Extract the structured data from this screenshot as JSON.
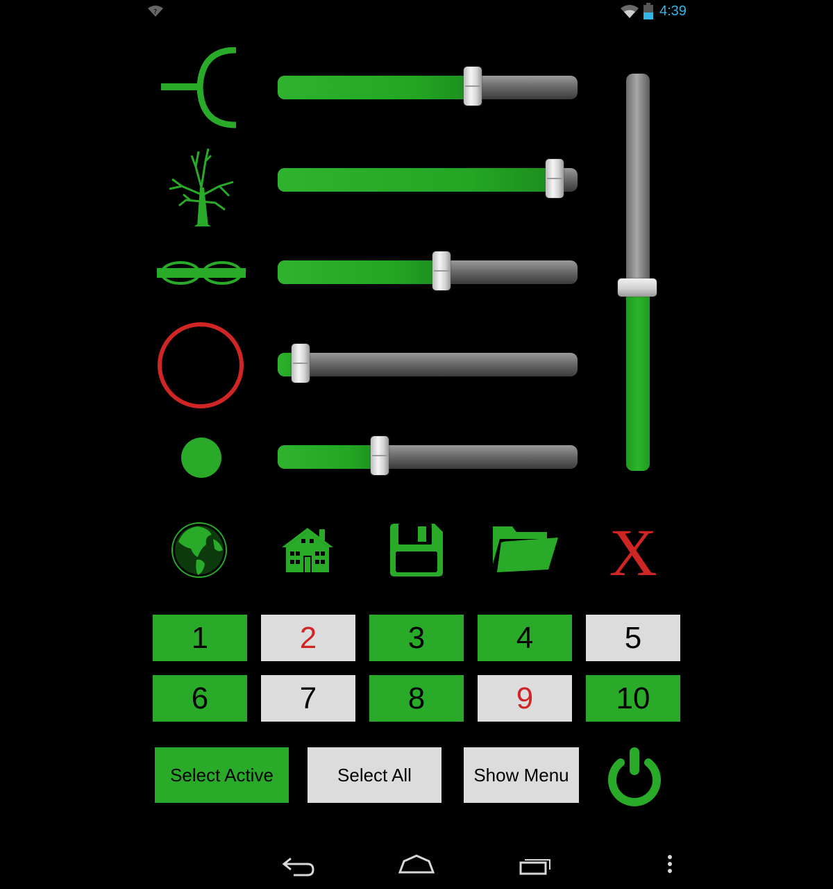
{
  "status_bar": {
    "time": "4:39",
    "icons": [
      "wifi-unknown-icon",
      "wifi-icon",
      "battery-icon"
    ]
  },
  "colors": {
    "accent_green": "#29aa29",
    "inactive_grey": "#dcdcdc",
    "alert_red": "#d02525",
    "status_blue": "#33b5e5"
  },
  "effects": [
    {
      "icon": "antenna-arc-icon",
      "level": 0.66
    },
    {
      "icon": "tree-icon",
      "level": 0.95
    },
    {
      "icon": "glasses-icon",
      "level": 0.55
    },
    {
      "icon": "ring-icon",
      "level": 0.05
    },
    {
      "icon": "dot-icon",
      "level": 0.33
    }
  ],
  "vertical_slider": {
    "level": 0.46
  },
  "toolbar": [
    "globe-icon",
    "house-icon",
    "floppy-disk-icon",
    "folder-icon",
    "close-x-icon"
  ],
  "channels": [
    {
      "label": "1",
      "active": true,
      "red": false
    },
    {
      "label": "2",
      "active": false,
      "red": true
    },
    {
      "label": "3",
      "active": true,
      "red": false
    },
    {
      "label": "4",
      "active": true,
      "red": false
    },
    {
      "label": "5",
      "active": false,
      "red": false
    },
    {
      "label": "6",
      "active": true,
      "red": false
    },
    {
      "label": "7",
      "active": false,
      "red": false
    },
    {
      "label": "8",
      "active": true,
      "red": false
    },
    {
      "label": "9",
      "active": false,
      "red": true
    },
    {
      "label": "10",
      "active": true,
      "red": false
    }
  ],
  "buttons": {
    "select_active": "Select Active",
    "select_all": "Select All",
    "show_menu": "Show Menu"
  },
  "nav_bar": [
    "back-icon",
    "home-icon",
    "recent-apps-icon",
    "overflow-menu-icon"
  ]
}
